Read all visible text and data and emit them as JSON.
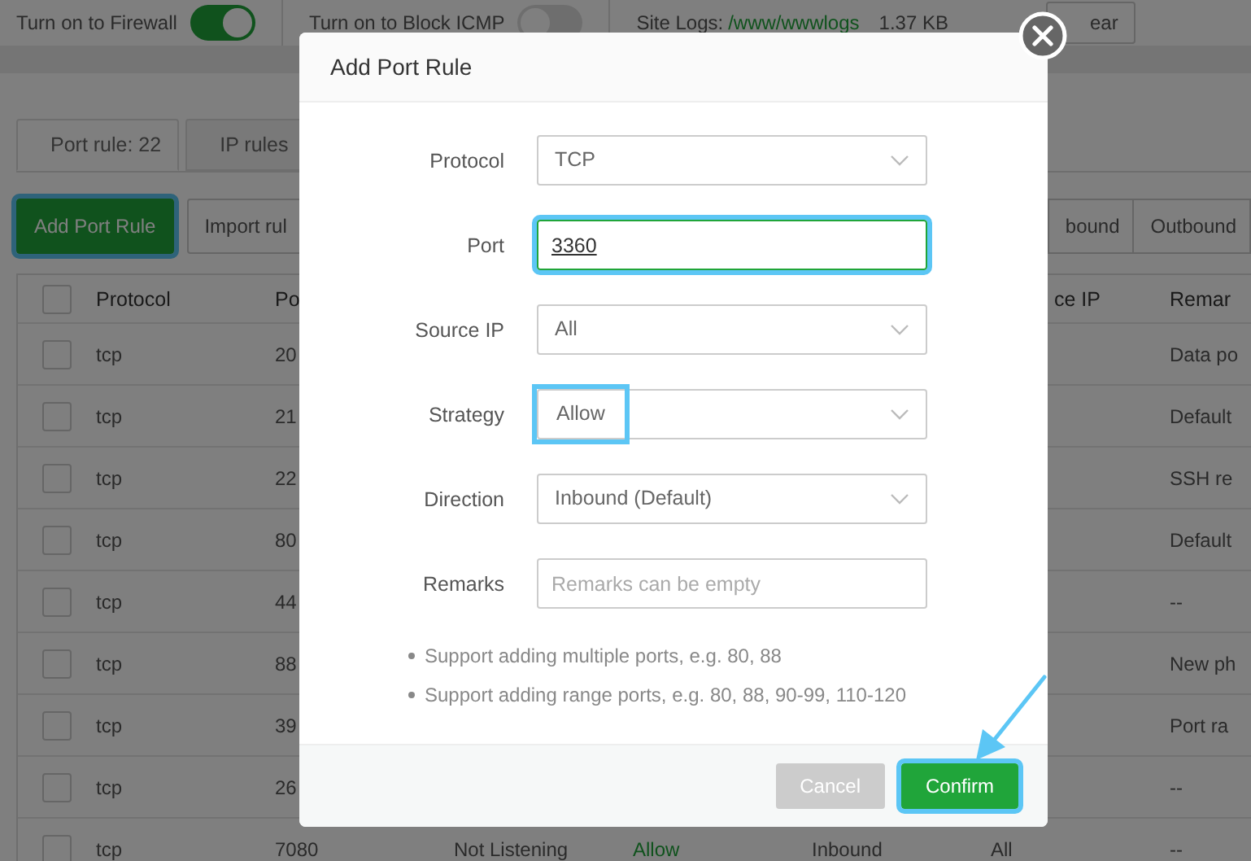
{
  "top_bar": {
    "toggles": [
      {
        "label": "Turn on to Firewall",
        "on": true
      },
      {
        "label": "Turn on to Block ICMP",
        "on": false
      }
    ],
    "site_logs": {
      "label": "Site Logs:",
      "path": "/www/wwwlogs",
      "size": "1.37 KB"
    },
    "clear_button": "ear"
  },
  "tabs": [
    {
      "label": "Port rule: 22",
      "selected": true
    },
    {
      "label": "IP rules",
      "selected": false
    }
  ],
  "toolbar": {
    "buttons": [
      {
        "label": "Add Port Rule",
        "primary": true,
        "highlighted": true
      },
      {
        "label": "Import rul",
        "primary": false,
        "highlighted": false
      }
    ],
    "filters": [
      "bound",
      "Outbound"
    ]
  },
  "table": {
    "header_checked": false,
    "header": {
      "protocol": "Protocol",
      "port": "Po",
      "source_ip": "ce IP",
      "remarks": "Remar"
    },
    "rows": [
      {
        "checked": false,
        "protocol": "tcp",
        "port": "20",
        "remarks": "Data po"
      },
      {
        "checked": false,
        "protocol": "tcp",
        "port": "21",
        "remarks": "Default"
      },
      {
        "checked": false,
        "protocol": "tcp",
        "port": "22",
        "remarks": "SSH re"
      },
      {
        "checked": false,
        "protocol": "tcp",
        "port": "80",
        "remarks": "Default"
      },
      {
        "checked": false,
        "protocol": "tcp",
        "port": "44",
        "remarks": "--"
      },
      {
        "checked": false,
        "protocol": "tcp",
        "port": "88",
        "remarks": "New ph"
      },
      {
        "checked": false,
        "protocol": "tcp",
        "port": "39",
        "remarks": "Port ra"
      },
      {
        "checked": false,
        "protocol": "tcp",
        "port": "26",
        "remarks": "--"
      },
      {
        "checked": false,
        "protocol": "tcp",
        "port": "7080",
        "status": "Not Listening",
        "strategy": "Allow",
        "direction": "Inbound",
        "source_ip": "All",
        "remarks": "--"
      }
    ]
  },
  "modal": {
    "title": "Add Port Rule",
    "fields": [
      {
        "label": "Protocol",
        "kind": "select",
        "value": "TCP",
        "highlighted": false
      },
      {
        "label": "Port",
        "kind": "input",
        "value": "3360",
        "highlighted": true
      },
      {
        "label": "Source IP",
        "kind": "select",
        "value": "All",
        "highlighted": false
      },
      {
        "label": "Strategy",
        "kind": "select",
        "value": "Allow",
        "highlighted": true
      },
      {
        "label": "Direction",
        "kind": "select",
        "value": "Inbound (Default)",
        "highlighted": false
      },
      {
        "label": "Remarks",
        "kind": "input",
        "placeholder": "Remarks can be empty",
        "highlighted": false
      }
    ],
    "notes": [
      "Support adding multiple ports, e.g. 80, 88",
      "Support adding range ports, e.g. 80, 88, 90-99, 110-120"
    ],
    "buttons": [
      {
        "label": "Cancel",
        "kind": "cancel",
        "disabled": true,
        "highlighted": false
      },
      {
        "label": "Confirm",
        "kind": "confirm",
        "disabled": false,
        "highlighted": true
      }
    ]
  }
}
